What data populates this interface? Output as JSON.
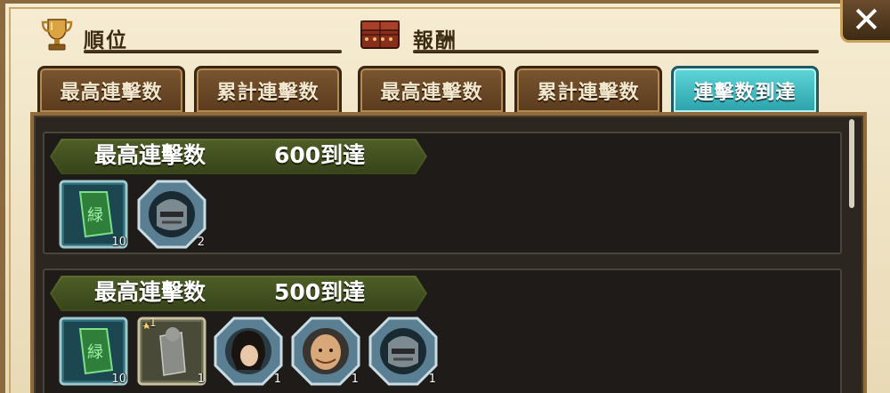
{
  "left_section": {
    "title": "順位",
    "icon": "trophy-icon"
  },
  "right_section": {
    "title": "報酬",
    "icon": "treasure-chest-icon"
  },
  "tabs": [
    {
      "label": "最高連擊数",
      "active": false
    },
    {
      "label": "累計連擊数",
      "active": false
    },
    {
      "label": "最高連擊数",
      "active": false
    },
    {
      "label": "累計連擊数",
      "active": false
    },
    {
      "label": "連擊数到達",
      "active": true
    }
  ],
  "close_button": {
    "label": "✕"
  },
  "cards": [
    {
      "label": "最高連擊数",
      "value": "600到達",
      "rewards": [
        {
          "icon": "green-jade-item-icon",
          "count": "10"
        },
        {
          "icon": "masked-character-icon",
          "count": "2"
        }
      ]
    },
    {
      "label": "最高連擊数",
      "value": "500到達",
      "rewards": [
        {
          "icon": "green-jade-item-icon",
          "count": "10"
        },
        {
          "icon": "stone-statue-item-icon",
          "count": "1",
          "rank": "1"
        },
        {
          "icon": "dark-haired-character-icon",
          "count": "1"
        },
        {
          "icon": "bald-character-icon",
          "count": "1"
        },
        {
          "icon": "masked-character-icon",
          "count": "1"
        }
      ]
    }
  ],
  "colors": {
    "active_tab": "#3cb8c0",
    "inactive_tab": "#6a4a27",
    "banner": "#4a5a20",
    "panel": "#2c2620"
  }
}
